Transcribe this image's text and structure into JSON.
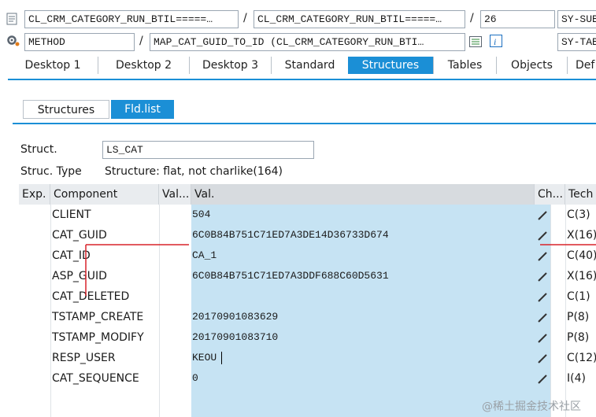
{
  "header": {
    "row1": {
      "program": "CL_CRM_CATEGORY_RUN_BTIL=====…",
      "include": "CL_CRM_CATEGORY_RUN_BTIL=====…",
      "line": "26",
      "right": "SY-SUB"
    },
    "row2": {
      "type": "METHOD",
      "event": "MAP_CAT_GUID_TO_ID (CL_CRM_CATEGORY_RUN_BTI…",
      "right": "SY-TAB"
    },
    "separator": "/"
  },
  "tabs": [
    "Desktop 1",
    "Desktop 2",
    "Desktop 3",
    "Standard",
    "Structures",
    "Tables",
    "Objects",
    "Def"
  ],
  "active_tab": "Structures",
  "subtabs": [
    "Structures",
    "Fld.list"
  ],
  "active_subtab": "Fld.list",
  "struct": {
    "label": "Struct.",
    "value": "LS_CAT",
    "type_label": "Struc. Type",
    "type_value": "Structure: flat, not charlike(164)"
  },
  "columns": {
    "exp": "Exp.",
    "component": "Component",
    "val_short": "Val...",
    "val": "Val.",
    "change": "Ch...",
    "tech": "Tech"
  },
  "rows": [
    {
      "component": "CLIENT",
      "value": "504",
      "tech": "C(3)"
    },
    {
      "component": "CAT_GUID",
      "value": "6C0B84B751C71ED7A3DE14D36733D674",
      "tech": "X(16)"
    },
    {
      "component": "CAT_ID",
      "value": "CA_1",
      "tech": "C(40)"
    },
    {
      "component": "ASP_GUID",
      "value": "6C0B84B751C71ED7A3DDF688C60D5631",
      "tech": "X(16)"
    },
    {
      "component": "CAT_DELETED",
      "value": "",
      "tech": "C(1)"
    },
    {
      "component": "TSTAMP_CREATE",
      "value": "20170901083629",
      "tech": "P(8)"
    },
    {
      "component": "TSTAMP_MODIFY",
      "value": "20170901083710",
      "tech": "P(8)"
    },
    {
      "component": "RESP_USER",
      "value": "KEOU",
      "tech": "C(12)"
    },
    {
      "component": "CAT_SEQUENCE",
      "value": "0",
      "tech": "I(4)"
    }
  ],
  "watermark": "@稀土掘金技术社区",
  "colors": {
    "accent": "#1b8fd6",
    "value_column": "#c6e3f3",
    "annotation": "#d9232a"
  }
}
